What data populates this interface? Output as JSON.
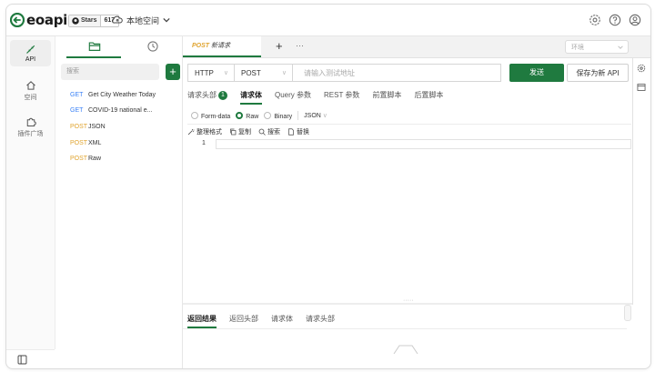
{
  "logo": {
    "text": "eoapi"
  },
  "github": {
    "stars_label": "Stars",
    "stars_count": "617"
  },
  "workspace": {
    "label": "本地空间"
  },
  "top_right_icons": [
    "settings-icon",
    "help-icon",
    "user-icon"
  ],
  "rail": {
    "items": [
      {
        "label": "API",
        "icon": "api-icon",
        "active": true
      },
      {
        "label": "空间",
        "icon": "home-icon",
        "active": false
      },
      {
        "label": "插件广场",
        "icon": "plugin-icon",
        "active": false
      }
    ]
  },
  "api_panel": {
    "tabs": [
      "folder-icon",
      "history-icon"
    ],
    "search_placeholder": "搜索",
    "add_label": "+",
    "apis": [
      {
        "method": "GET",
        "name": "Get City Weather Today"
      },
      {
        "method": "GET",
        "name": "COVID-19 national e..."
      },
      {
        "method": "POST",
        "name": "JSON"
      },
      {
        "method": "POST",
        "name": "XML"
      },
      {
        "method": "POST",
        "name": "Raw"
      }
    ]
  },
  "tabs": {
    "active_method": "POST",
    "active_title": "新请求",
    "add_label": "+",
    "more_label": "···"
  },
  "env": {
    "placeholder": "环境"
  },
  "request": {
    "protocol": "HTTP",
    "method": "POST",
    "url_placeholder": "请输入测试地址",
    "send_label": "发送",
    "save_label": "保存为新 API"
  },
  "request_tabs": {
    "items": [
      "请求头部",
      "请求体",
      "Query 参数",
      "REST 参数",
      "前置脚本",
      "后置脚本"
    ],
    "header_badge": "1"
  },
  "body_types": {
    "options": [
      "Form-data",
      "Raw",
      "Binary"
    ],
    "selected": "Raw",
    "format": "JSON"
  },
  "editor_tools": {
    "format_label": "整理格式",
    "copy_label": "复制",
    "search_label": "搜索",
    "replace_label": "替换"
  },
  "editor": {
    "line_number": "1"
  },
  "response_tabs": {
    "items": [
      "返回结果",
      "返回头部",
      "请求体",
      "请求头部"
    ]
  },
  "colors": {
    "primary": "#1f7a3f",
    "get_method": "#3b82f6",
    "post_method": "#e0a42f"
  }
}
